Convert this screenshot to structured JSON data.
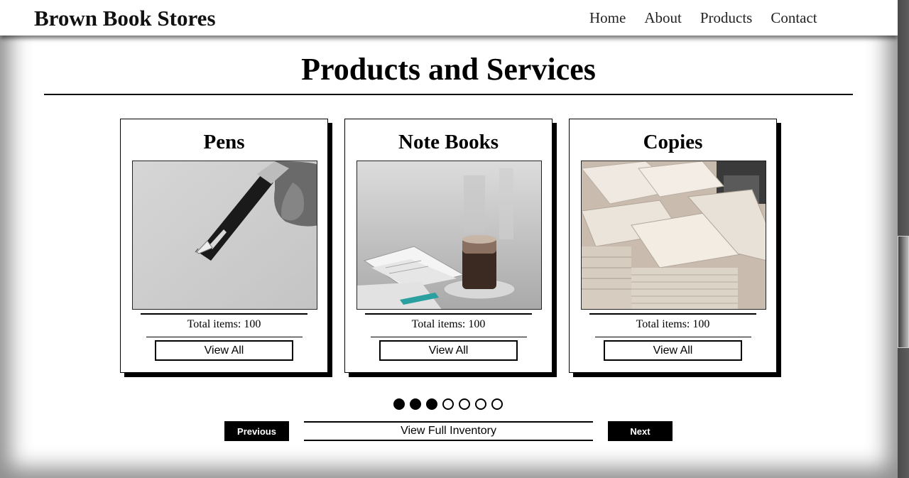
{
  "header": {
    "brand": "Brown Book Stores",
    "nav": [
      "Home",
      "About",
      "Products",
      "Contact"
    ]
  },
  "main": {
    "heading": "Products and Services",
    "cards": [
      {
        "title": "Pens",
        "count": "Total items: 100",
        "button": "View All",
        "image": "fountain-pen-photo"
      },
      {
        "title": "Note Books",
        "count": "Total items: 100",
        "button": "View All",
        "image": "notebook-coffee-photo"
      },
      {
        "title": "Copies",
        "count": "Total items: 100",
        "button": "View All",
        "image": "paper-stacks-photo"
      }
    ]
  },
  "carousel": {
    "dots_total": 7,
    "dots_filled": 3,
    "previous_label": "Previous",
    "inventory_label": "View Full Inventory",
    "next_label": "Next"
  },
  "colors": {
    "accent": "#000000",
    "background": "#ffffff"
  }
}
